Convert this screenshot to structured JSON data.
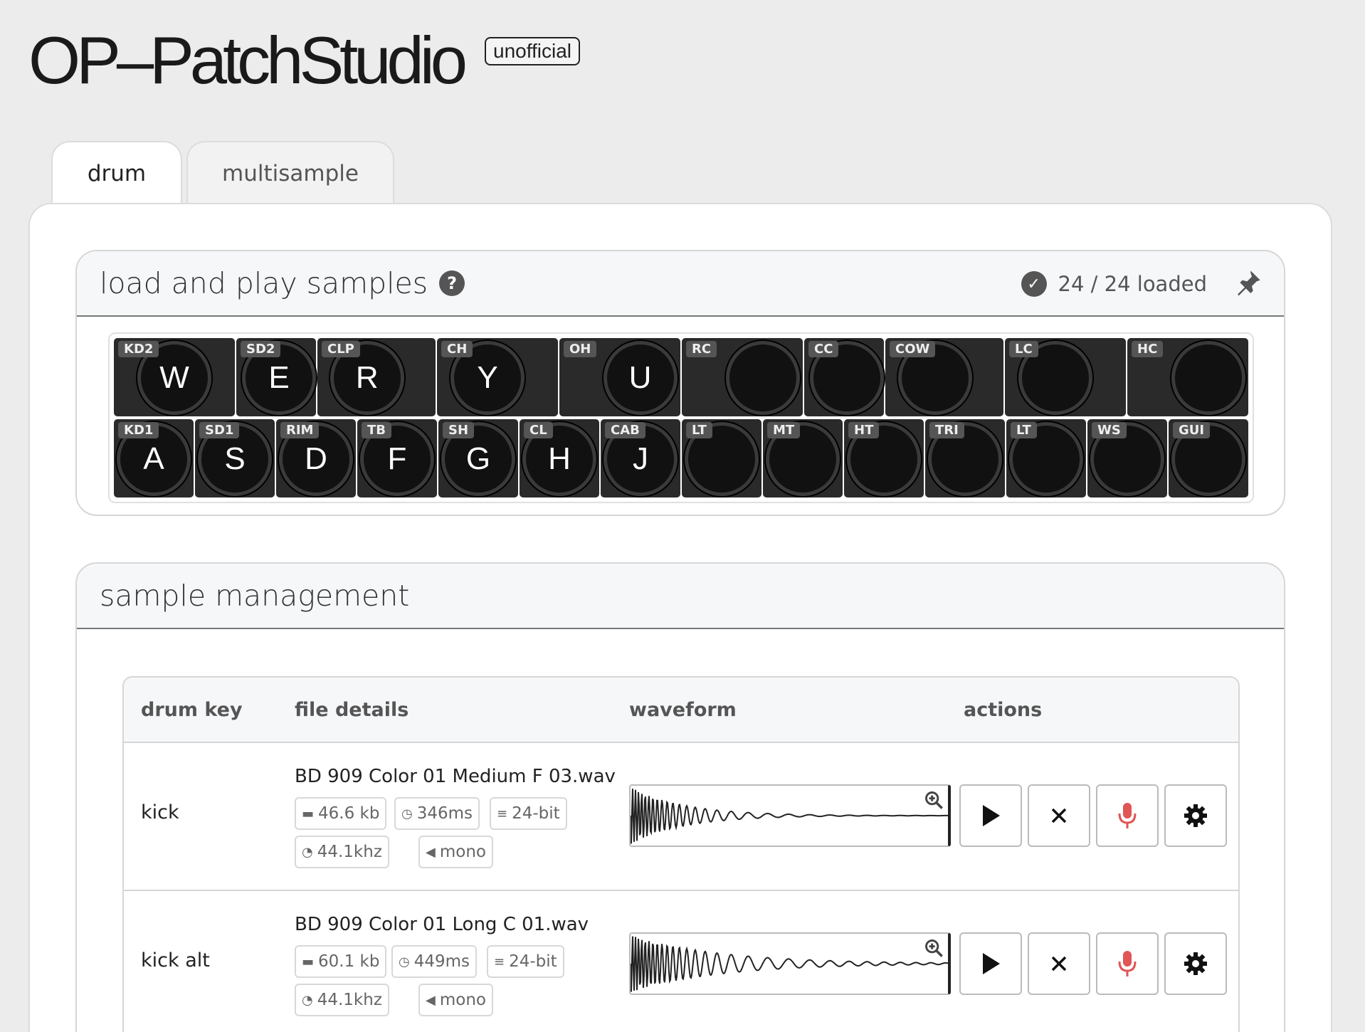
{
  "app": {
    "title": "OP–PatchStudio",
    "badge": "unofficial"
  },
  "tabs": [
    {
      "label": "drum"
    },
    {
      "label": "multisample"
    }
  ],
  "samples_panel": {
    "title": "load and play samples",
    "help_icon": "question-circle-icon",
    "status": "24 / 24 loaded",
    "status_icon": "check-circle-icon",
    "pin_icon": "pin-icon",
    "top_row": [
      {
        "tag": "KD2",
        "key": "W"
      },
      {
        "tag": "SD2",
        "key": "E"
      },
      {
        "tag": "CLP",
        "key": "R"
      },
      {
        "tag": "CH",
        "key": "Y"
      },
      {
        "tag": "OH",
        "key": "U"
      },
      {
        "tag": "RC",
        "key": ""
      },
      {
        "tag": "CC",
        "key": ""
      },
      {
        "tag": "COW",
        "key": ""
      },
      {
        "tag": "LC",
        "key": ""
      },
      {
        "tag": "HC",
        "key": ""
      }
    ],
    "bottom_row": [
      {
        "tag": "KD1",
        "key": "A"
      },
      {
        "tag": "SD1",
        "key": "S"
      },
      {
        "tag": "RIM",
        "key": "D"
      },
      {
        "tag": "TB",
        "key": "F"
      },
      {
        "tag": "SH",
        "key": "G"
      },
      {
        "tag": "CL",
        "key": "H"
      },
      {
        "tag": "CAB",
        "key": "J"
      },
      {
        "tag": "LT",
        "key": ""
      },
      {
        "tag": "MT",
        "key": ""
      },
      {
        "tag": "HT",
        "key": ""
      },
      {
        "tag": "TRI",
        "key": ""
      },
      {
        "tag": "LT",
        "key": ""
      },
      {
        "tag": "WS",
        "key": ""
      },
      {
        "tag": "GUI",
        "key": ""
      }
    ]
  },
  "management_panel": {
    "title": "sample management",
    "columns": {
      "drum_key": "drum key",
      "file_details": "file details",
      "waveform": "waveform",
      "actions": "actions"
    },
    "rows": [
      {
        "drum_key": "kick",
        "file_name": "BD 909 Color 01 Medium F 03.wav",
        "size": "46.6 kb",
        "duration": "346ms",
        "bit_depth": "24-bit",
        "sample_rate": "44.1khz",
        "channels": "mono"
      },
      {
        "drum_key": "kick alt",
        "file_name": "BD 909 Color 01 Long C 01.wav",
        "size": "60.1 kb",
        "duration": "449ms",
        "bit_depth": "24-bit",
        "sample_rate": "44.1khz",
        "channels": "mono"
      }
    ],
    "action_icons": [
      "play-icon",
      "close-icon",
      "microphone-icon",
      "gear-icon"
    ],
    "colors": {
      "mic": "#e05555"
    }
  }
}
